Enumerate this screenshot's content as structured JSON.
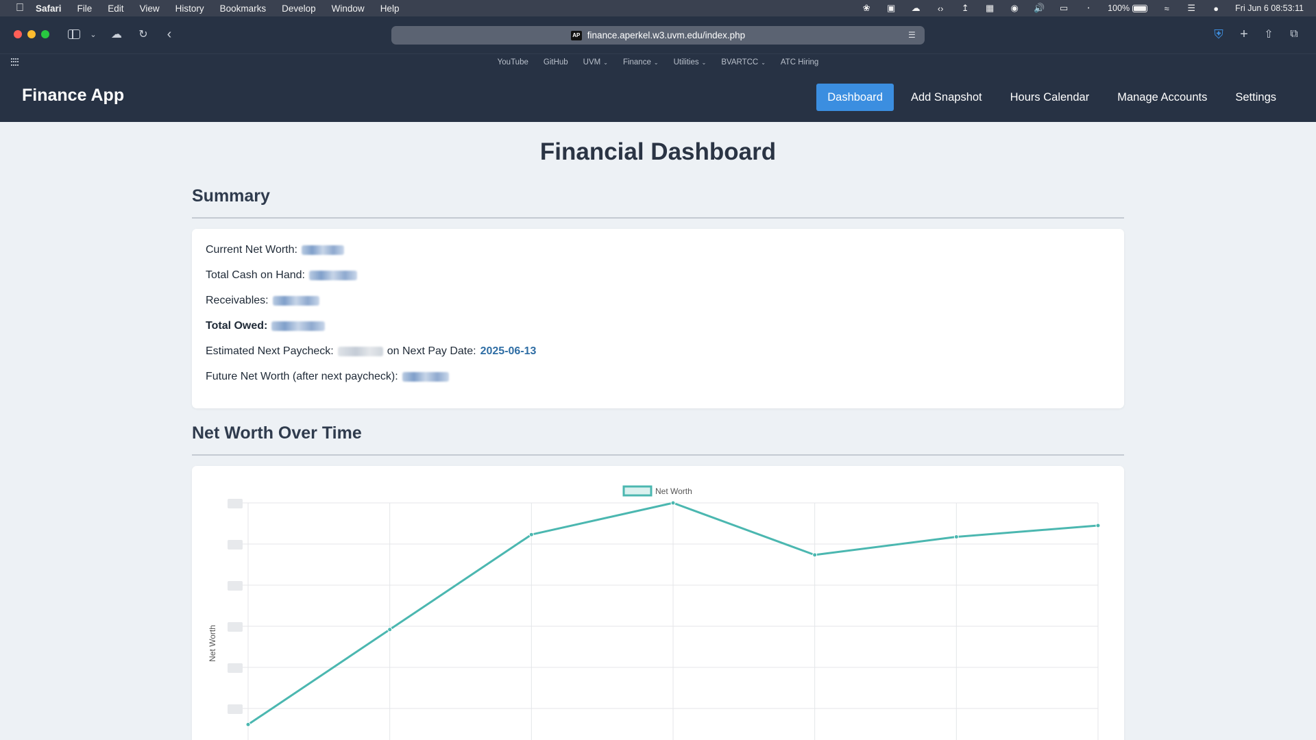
{
  "menubar": {
    "app_name": "Safari",
    "items": [
      "File",
      "Edit",
      "View",
      "History",
      "Bookmarks",
      "Develop",
      "Window",
      "Help"
    ],
    "battery": "100%",
    "datetime": "Fri Jun 6  08:53:11"
  },
  "browser": {
    "url": "finance.aperkel.w3.uvm.edu/index.php",
    "site_badge": "AP",
    "favorites": [
      {
        "label": "YouTube",
        "menu": false
      },
      {
        "label": "GitHub",
        "menu": false
      },
      {
        "label": "UVM",
        "menu": true
      },
      {
        "label": "Finance",
        "menu": true
      },
      {
        "label": "Utilities",
        "menu": true
      },
      {
        "label": "BVARTCC",
        "menu": true
      },
      {
        "label": "ATC Hiring",
        "menu": false
      }
    ]
  },
  "nav": {
    "brand": "Finance App",
    "links": [
      {
        "label": "Dashboard",
        "active": true
      },
      {
        "label": "Add Snapshot",
        "active": false
      },
      {
        "label": "Hours Calendar",
        "active": false
      },
      {
        "label": "Manage Accounts",
        "active": false
      },
      {
        "label": "Settings",
        "active": false
      }
    ]
  },
  "page": {
    "title": "Financial Dashboard",
    "summary_heading": "Summary",
    "chart_heading": "Net Worth Over Time"
  },
  "summary": {
    "net_worth_label": "Current Net Worth:",
    "cash_label": "Total Cash on Hand:",
    "receivables_label": "Receivables:",
    "owed_label": "Total Owed:",
    "paycheck_label": "Estimated Next Paycheck:",
    "pay_date_label": "on Next Pay Date:",
    "pay_date": "2025-06-13",
    "future_label": "Future Net Worth (after next paycheck):"
  },
  "chart_data": {
    "type": "line",
    "ylabel": "Net Worth",
    "series": [
      {
        "name": "Net Worth",
        "color": "#4bb7b0",
        "values": [
          0.02,
          0.44,
          0.86,
          1.0,
          0.77,
          0.85,
          0.9
        ]
      }
    ]
  }
}
